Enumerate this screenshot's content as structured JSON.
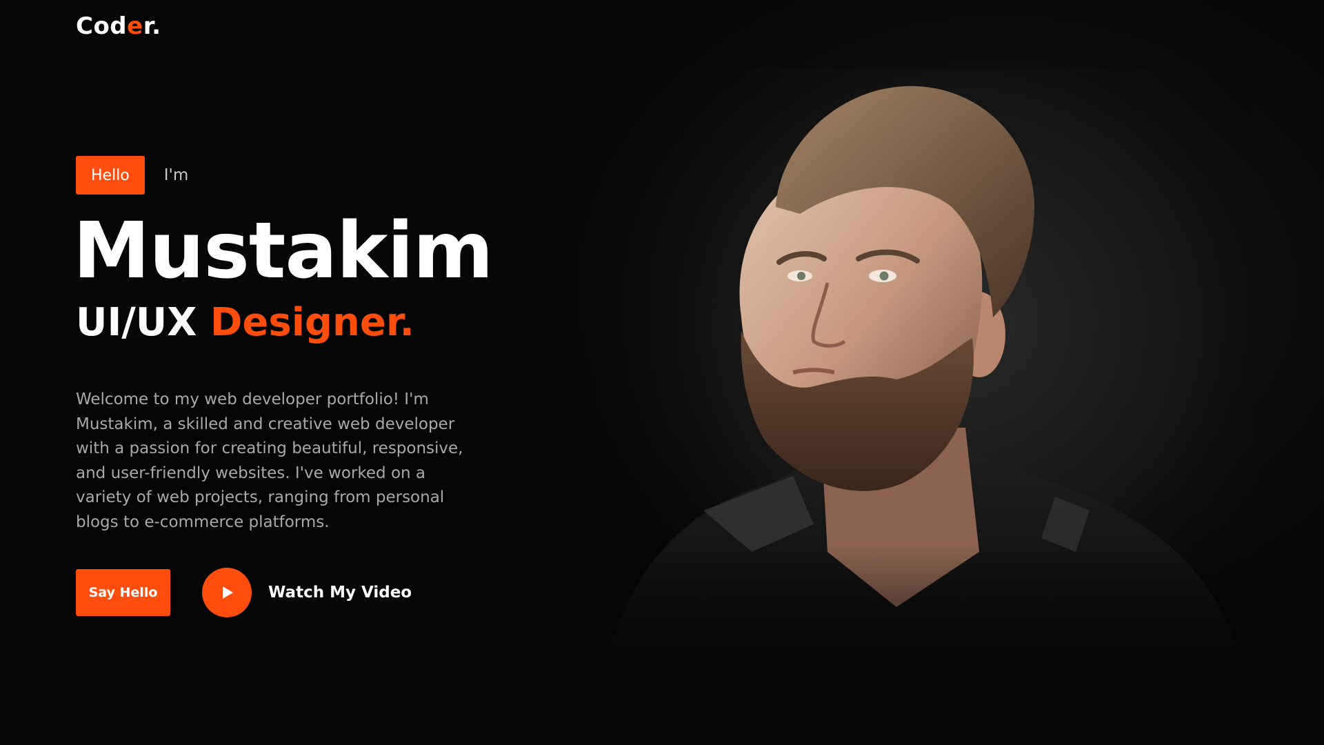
{
  "brand": {
    "logo_part1": "Cod",
    "logo_part2": "e",
    "logo_part3": "r."
  },
  "hero": {
    "badge": "Hello",
    "intro": "I'm",
    "name": "Mustakim",
    "role_main": "UI/UX ",
    "role_accent": "Designer.",
    "bio": "Welcome to my web developer portfolio! I'm Mustakim, a skilled and creative web developer with a passion for creating beautiful, responsive, and user-friendly websites. I've worked on a variety of web projects, ranging from personal blogs to e-commerce platforms."
  },
  "cta": {
    "primary_label": "Say Hello",
    "video_label": "Watch My Video"
  },
  "icons": {
    "play": "play-icon"
  },
  "colors": {
    "accent": "#ff4d0d",
    "background": "#050505",
    "text_primary": "#ffffff",
    "text_muted": "#a9a9a9"
  }
}
